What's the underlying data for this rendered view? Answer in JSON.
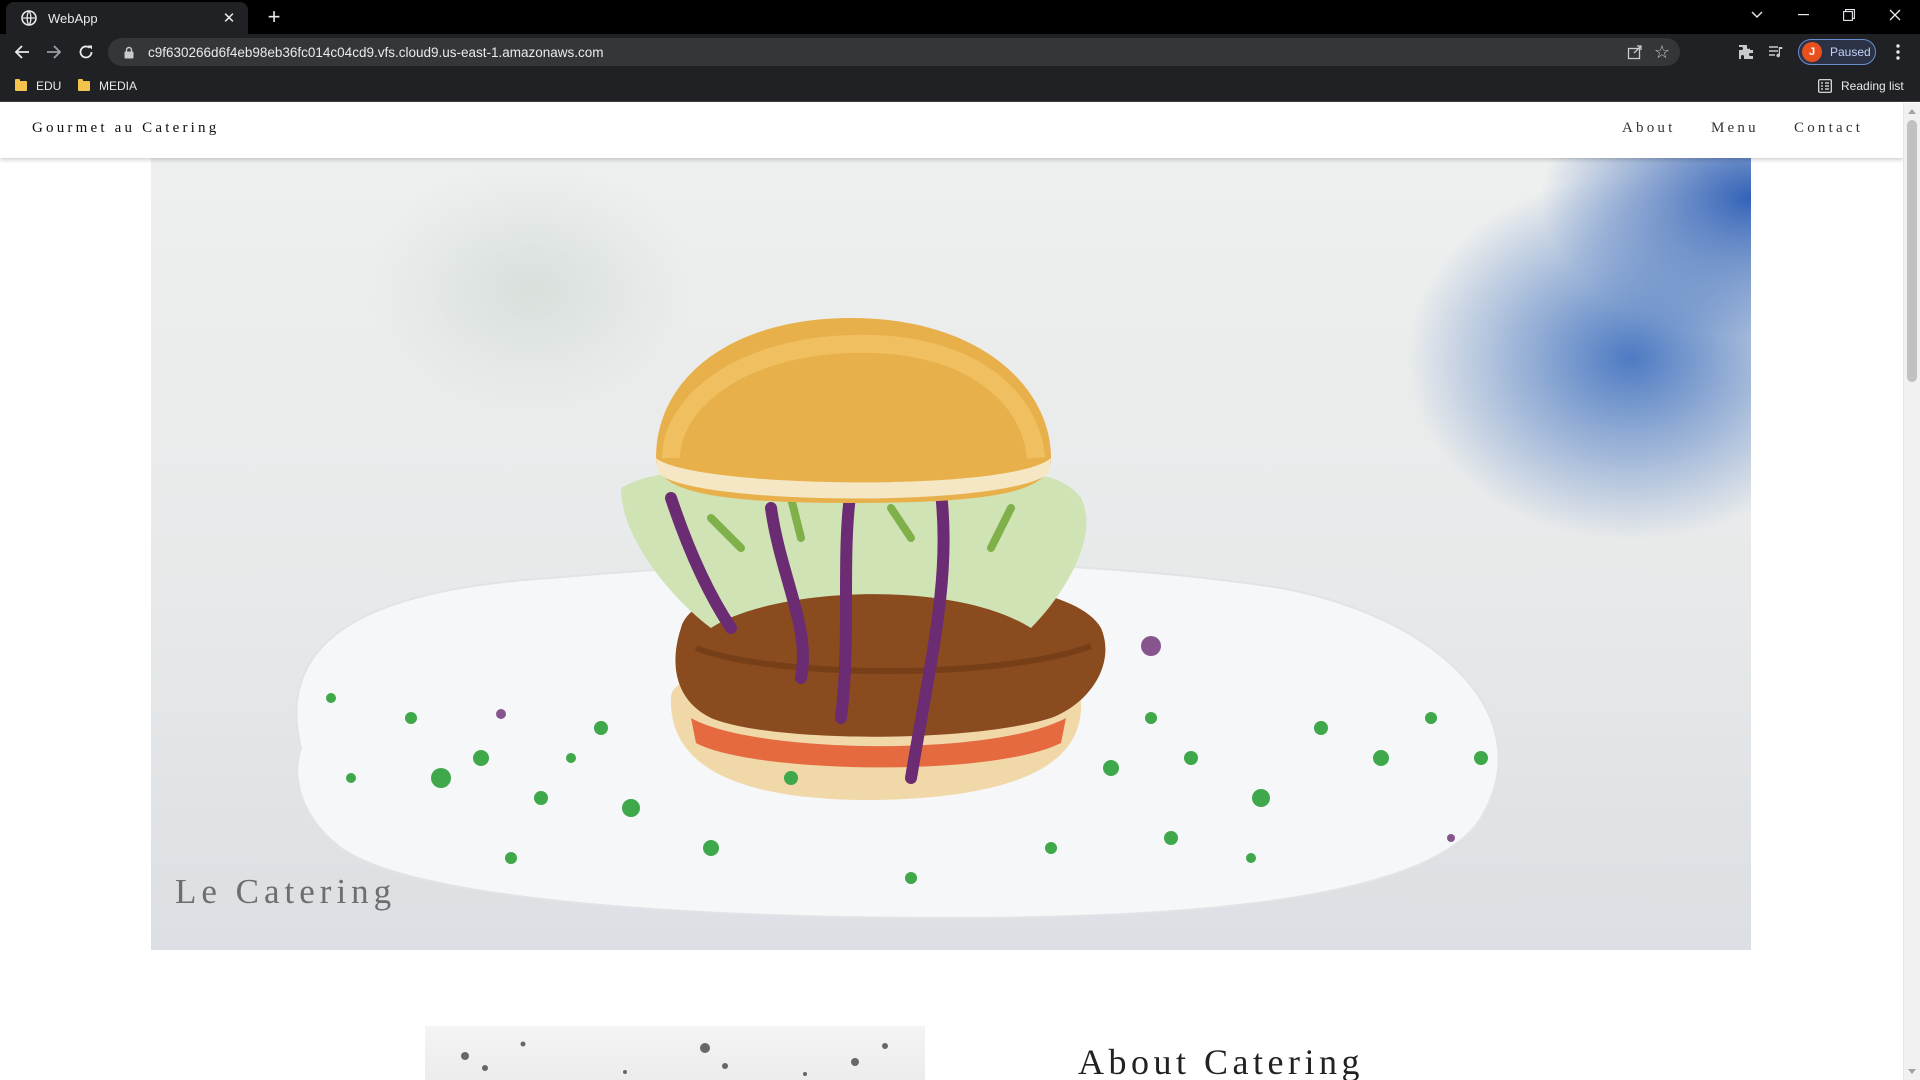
{
  "browser": {
    "tab_title": "WebApp",
    "url": "c9f630266d6f4eb98eb36fc014c04cd9.vfs.cloud9.us-east-1.amazonaws.com",
    "profile_initial": "J",
    "profile_status": "Paused",
    "bookmarks": [
      {
        "label": "EDU"
      },
      {
        "label": "MEDIA"
      }
    ],
    "reading_list": "Reading list"
  },
  "site": {
    "brand": "Gourmet au Catering",
    "nav": {
      "about": "About",
      "menu": "Menu",
      "contact": "Contact"
    },
    "hero": {
      "caption": "Le Catering"
    },
    "about": {
      "title": "About Catering"
    }
  },
  "colors": {
    "chrome_dark": "#202124",
    "profile_avatar": "#e8501e",
    "page_background": "#ffffff"
  }
}
